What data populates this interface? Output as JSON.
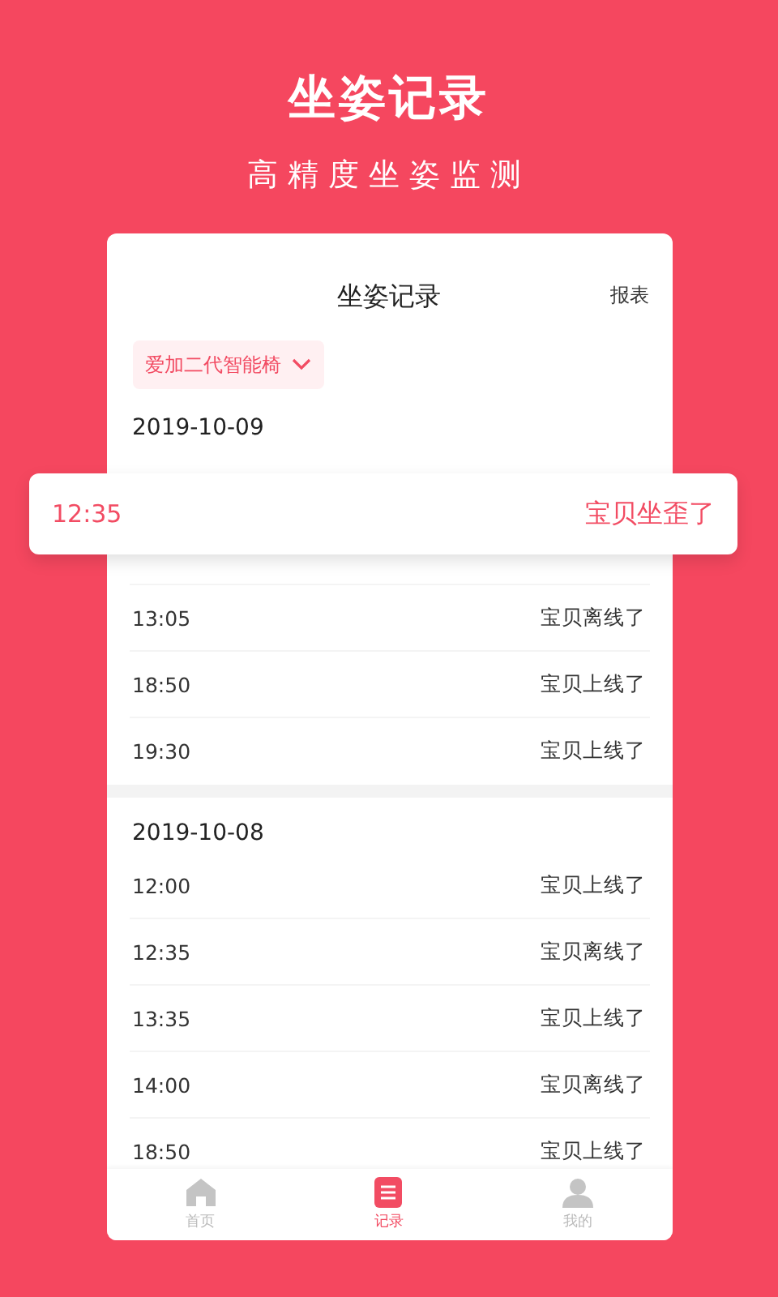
{
  "headline": "坐姿记录",
  "subtitle": "高精度坐姿监测",
  "card": {
    "title": "坐姿记录",
    "report_link": "报表",
    "device_selector": "爱加二代智能椅",
    "groups": [
      {
        "date": "2019-10-09",
        "records": [
          {
            "time": "13:05",
            "event": "宝贝离线了"
          },
          {
            "time": "18:50",
            "event": "宝贝上线了"
          },
          {
            "time": "19:30",
            "event": "宝贝上线了"
          }
        ]
      },
      {
        "date": "2019-10-08",
        "records": [
          {
            "time": "12:00",
            "event": "宝贝上线了"
          },
          {
            "time": "12:35",
            "event": "宝贝离线了"
          },
          {
            "time": "13:35",
            "event": "宝贝上线了"
          },
          {
            "time": "14:00",
            "event": "宝贝离线了"
          },
          {
            "time": "18:50",
            "event": "宝贝上线了"
          }
        ]
      }
    ],
    "tabs": [
      {
        "label": "首页",
        "kind": "home",
        "selected": false
      },
      {
        "label": "记录",
        "kind": "list",
        "selected": true
      },
      {
        "label": "我的",
        "kind": "user",
        "selected": false
      }
    ]
  },
  "popup": {
    "time": "12:35",
    "event": "宝贝坐歪了"
  }
}
